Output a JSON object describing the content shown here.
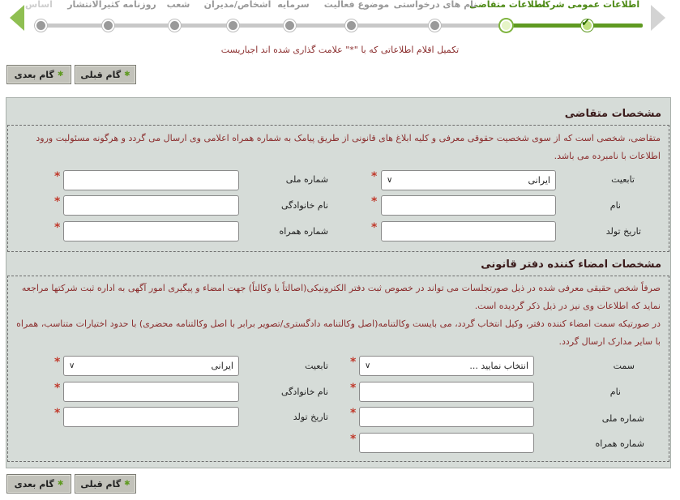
{
  "steps": [
    {
      "label": "اطلاعات عمومی شرکت",
      "state": "done"
    },
    {
      "label": "اطلاعات متقاضی",
      "state": "current"
    },
    {
      "label": "نام های درخواستی",
      "state": "pending"
    },
    {
      "label": "موضوع فعالیت",
      "state": "pending"
    },
    {
      "label": "سرمایه",
      "state": "pending"
    },
    {
      "label": "اشخاص/مدیران",
      "state": "pending"
    },
    {
      "label": "شعب",
      "state": "pending"
    },
    {
      "label": "روزنامه کثیرالانتشار",
      "state": "pending"
    },
    {
      "label": "اساس",
      "state": "faded"
    }
  ],
  "notice": "تکمیل اقلام اطلاعاتی که با \"*\" علامت گذاری شده اند اجباریست",
  "nav": {
    "next_label": "گام بعدی",
    "prev_label": "گام قبلی"
  },
  "applicant": {
    "title": "مشخصات متقاضی",
    "description": "متقاضی، شخصی است که از سوی شخصیت حقوقی معرفی و کلیه ابلاغ های قانونی از طریق پیامک به شماره همراه اعلامی وی ارسال می گردد و هرگونه مسئولیت ورود اطلاعات با نامبرده می باشد.",
    "nationality_label": "تابعیت",
    "nationality_value": "ایرانی",
    "national_id_label": "شماره ملی",
    "first_name_label": "نام",
    "last_name_label": "نام خانوادگی",
    "birth_date_label": "تاریخ تولد",
    "mobile_label": "شماره همراه"
  },
  "signer": {
    "title": "مشخصات امضاء کننده دفتر قانونی",
    "description1": "صرفاً شخص حقیقی معرفی شده در ذیل صورتجلسات می تواند در خصوص ثبت دفتر الکترونیکی(اصالتاً یا وکالتاً) جهت امضاء و پیگیری امور آگهی به اداره ثبت شرکتها مراجعه نماید که اطلاعات وی نیز در ذیل ذکر گردیده است.",
    "description2": "در صورتیکه سمت امضاء کننده دفتر، وکیل انتخاب گردد، می بایست وکالتنامه(اصل وکالتنامه دادگستری/تصویر برابر با اصل وکالتنامه محضری) با حدود اختیارات متناسب، همراه با سایر مدارک ارسال گردد.",
    "role_label": "سمت",
    "role_value": "انتخاب نمایید ...",
    "nationality_label": "تابعیت",
    "nationality_value": "ایرانی",
    "first_name_label": "نام",
    "last_name_label": "نام خانوادگی",
    "national_id_label": "شماره ملی",
    "birth_date_label": "تاریخ تولد",
    "mobile_label": "شماره همراه"
  },
  "required_mark": "*",
  "icons": {
    "check": "check-icon",
    "star": "star-icon",
    "chevron": "chevron-down-icon"
  }
}
